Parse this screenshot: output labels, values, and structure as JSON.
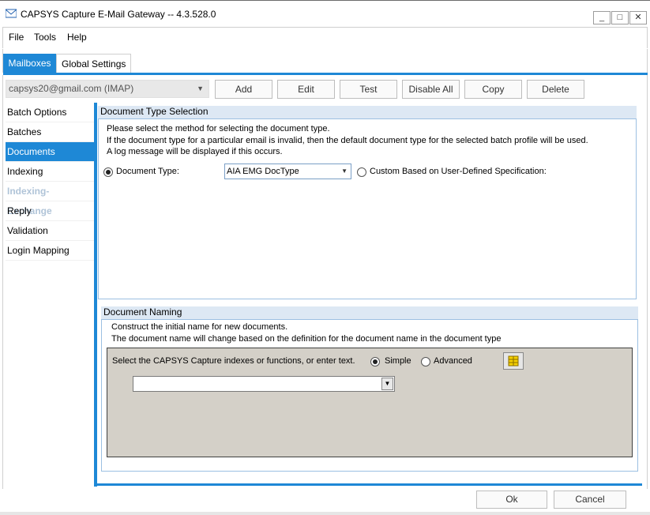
{
  "window": {
    "title": "CAPSYS Capture E-Mail Gateway -- 4.3.528.0",
    "minimize": "_",
    "maximize": "□",
    "close": "✕"
  },
  "menu": [
    "File",
    "Tools",
    "Help"
  ],
  "tabs": [
    "Mailboxes",
    "Global Settings"
  ],
  "toolbar": {
    "account": "capsys20@gmail.com (IMAP)",
    "buttons": [
      "Add",
      "Edit",
      "Test",
      "Disable All",
      "Copy",
      "Delete"
    ]
  },
  "nav": [
    {
      "label": "Batch Options",
      "state": "normal"
    },
    {
      "label": "Batches",
      "state": "normal"
    },
    {
      "label": "Documents",
      "state": "active"
    },
    {
      "label": "Indexing",
      "state": "normal"
    },
    {
      "label": "Indexing-Exchange",
      "state": "disabled"
    },
    {
      "label": "Reply",
      "state": "normal"
    },
    {
      "label": "Validation",
      "state": "normal"
    },
    {
      "label": "Login Mapping",
      "state": "normal"
    }
  ],
  "doctype_section": {
    "header": "Document Type Selection",
    "line1": "Please select the method for selecting the document type.",
    "line2": "If the document type for a particular email is invalid, then the default document type for the selected batch profile will be used.",
    "line3": "A log message will be displayed if this occurs.",
    "radio_doctype": "Document Type:",
    "doctype_value": "AIA EMG DocType",
    "radio_custom": "Custom Based on User-Defined Specification:"
  },
  "naming_section": {
    "header": "Document Naming",
    "line1": "Construct the initial name for new documents.",
    "line2": "The document name will change based on the definition for the document name in the document type",
    "panel_label": "Select the CAPSYS Capture indexes or functions, or enter text.",
    "radio_simple": "Simple",
    "radio_advanced": "Advanced",
    "combo_value": ""
  },
  "footer": {
    "ok": "Ok",
    "cancel": "Cancel"
  },
  "colors": {
    "accent": "#1e88d6",
    "group_header": "#dde8f4",
    "panel_gray": "#d4d0c8"
  }
}
